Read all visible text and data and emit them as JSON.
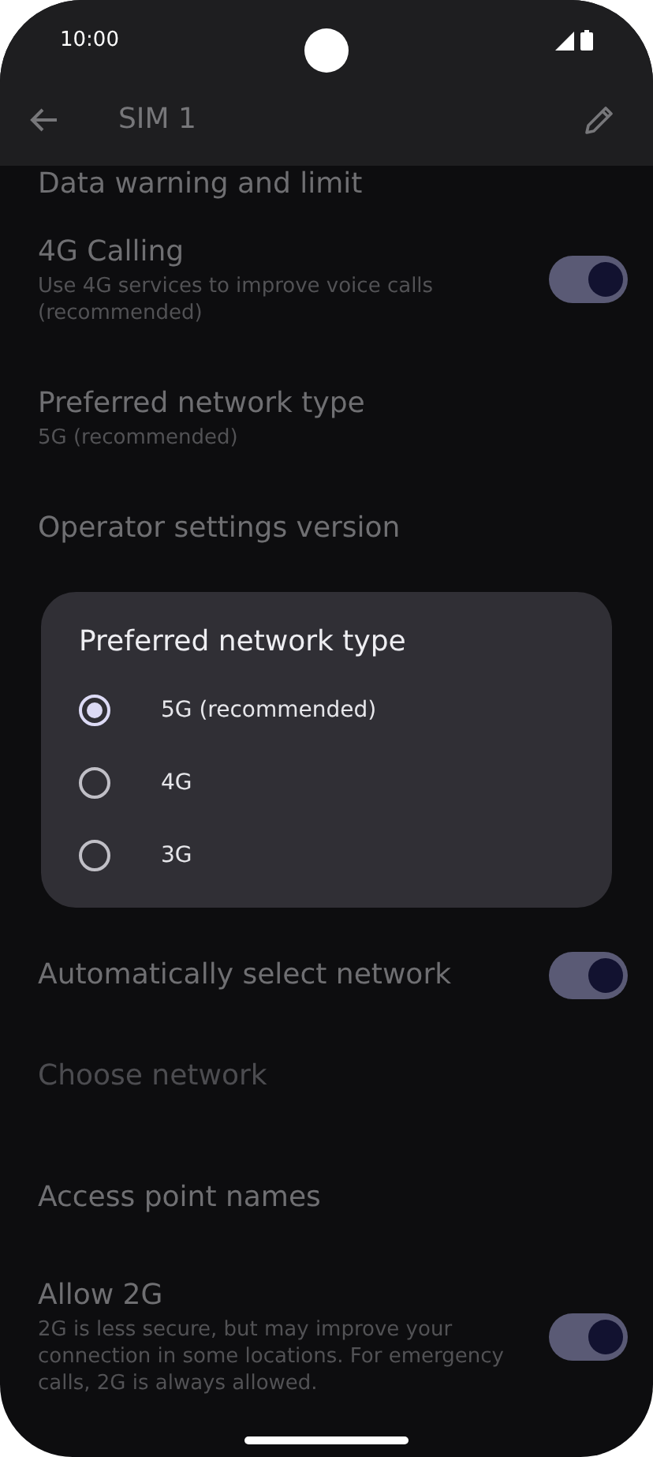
{
  "status_bar": {
    "time": "10:00"
  },
  "app_bar": {
    "title": "SIM 1"
  },
  "settings_top": [
    {
      "kind": "plain",
      "title": "Data warning and limit",
      "disabled": false
    },
    {
      "kind": "toggle",
      "title": "4G Calling",
      "subtitle": "Use 4G services to improve voice calls (recommended)",
      "on": true,
      "disabled": false
    },
    {
      "kind": "plain",
      "title": "Preferred network type",
      "subtitle": "5G (recommended)",
      "disabled": false
    },
    {
      "kind": "plain",
      "title": "Operator settings version",
      "disabled": false
    }
  ],
  "settings_bottom": [
    {
      "kind": "toggle",
      "title": "Automatically select network",
      "on": true,
      "disabled": false
    },
    {
      "kind": "plain",
      "title": "Choose network",
      "disabled": true
    },
    {
      "kind": "plain",
      "title": "Access point names",
      "disabled": false
    },
    {
      "kind": "toggle",
      "title": "Allow 2G",
      "subtitle": "2G is less secure, but may improve your connection in some locations. For emergency calls, 2G is always allowed.",
      "on": true,
      "disabled": false
    }
  ],
  "dialog": {
    "title": "Preferred network type",
    "options": [
      {
        "label": "5G (recommended)",
        "selected": true
      },
      {
        "label": "4G",
        "selected": false
      },
      {
        "label": "3G",
        "selected": false
      }
    ]
  }
}
